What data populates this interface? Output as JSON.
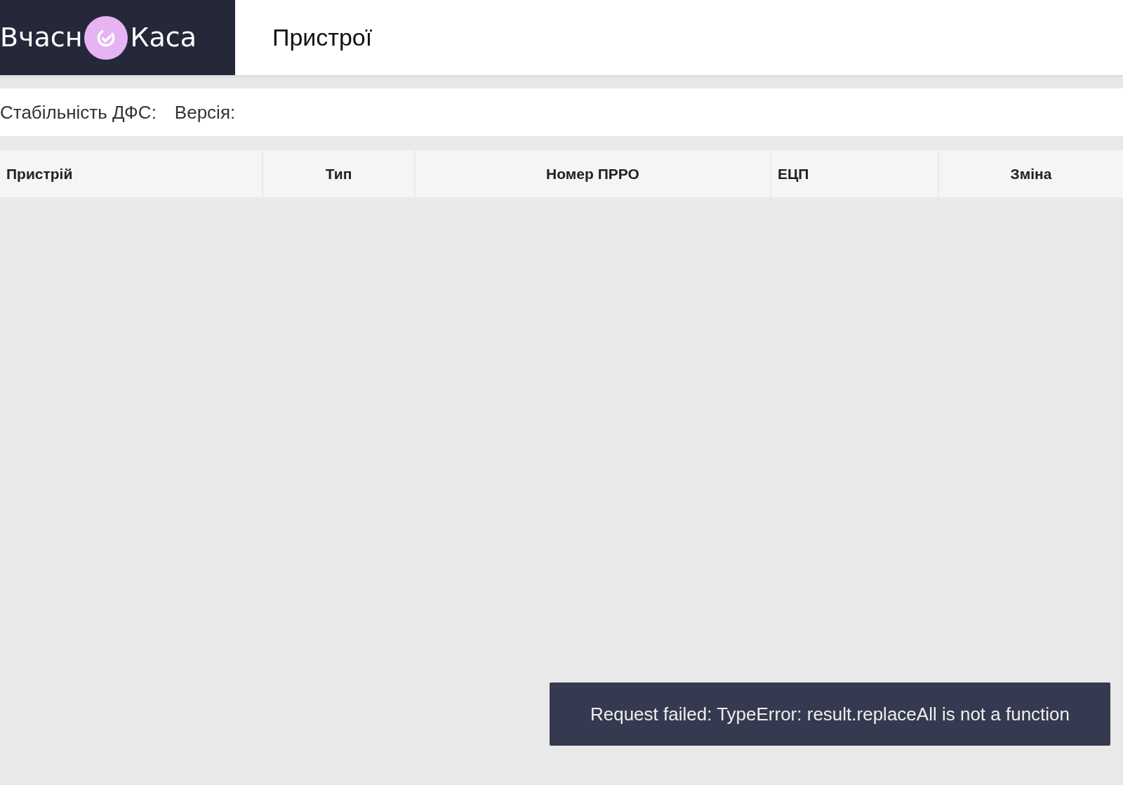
{
  "logo": {
    "left": "Вчасн",
    "right": "Каса"
  },
  "page_title": "Пристрої",
  "info_bar": [
    "Стабільність ДФС:",
    "Версія:"
  ],
  "table": {
    "columns": [
      "Пристрій",
      "Тип",
      "Номер ПРРО",
      "ЕЦП",
      "Зміна"
    ]
  },
  "toast": "Request failed: TypeError: result.replaceAll is not a function"
}
